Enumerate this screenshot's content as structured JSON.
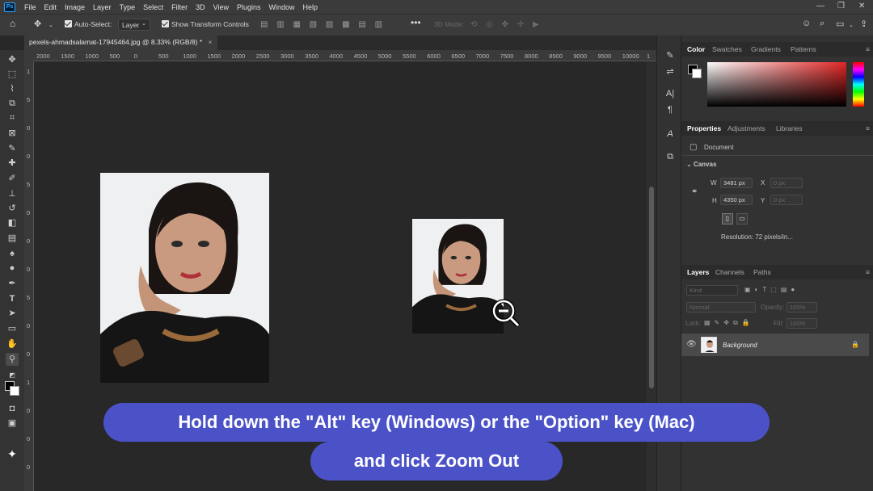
{
  "menu": [
    "File",
    "Edit",
    "Image",
    "Layer",
    "Type",
    "Select",
    "Filter",
    "3D",
    "View",
    "Plugins",
    "Window",
    "Help"
  ],
  "options": {
    "auto_select_label": "Auto-Select:",
    "auto_select_value": "Layer",
    "show_transform_label": "Show Transform Controls",
    "mode_3d_label": "3D Mode:"
  },
  "document": {
    "tab_title": "pexels-ahmadsalamat-17945464.jpg @ 8.33% (RGB/8) *",
    "close": "×"
  },
  "ruler_labels": [
    "2000",
    "1500",
    "1000",
    "500",
    "0",
    "500",
    "1000",
    "1500",
    "2000",
    "2500",
    "3000",
    "3500",
    "4000",
    "4500",
    "5000",
    "5500",
    "6000",
    "6500",
    "7000",
    "7500",
    "8000",
    "8500",
    "9000",
    "9500",
    "10000",
    "1"
  ],
  "ruler_v_labels": [
    "1",
    "5",
    "0",
    "0",
    "5",
    "0",
    "0",
    "0",
    "5",
    "0",
    "0",
    "1",
    "0",
    "0",
    "0"
  ],
  "panels": {
    "color_tabs": [
      "Color",
      "Swatches",
      "Gradients",
      "Patterns"
    ],
    "props_tabs": [
      "Properties",
      "Adjustments",
      "Libraries"
    ],
    "properties": {
      "doc_label": "Document",
      "canvas_label": "Canvas",
      "w_label": "W",
      "w_value": "3481 px",
      "h_label": "H",
      "h_value": "4350 px",
      "x_label": "X",
      "x_value": "0 px",
      "y_label": "Y",
      "y_value": "0 px",
      "resolution": "Resolution: 72 pixels/in..."
    },
    "layers_tabs": [
      "Layers",
      "Channels",
      "Paths"
    ],
    "layers": {
      "kind_placeholder": "Kind",
      "blend_mode": "Normal",
      "opacity_label": "Opacity:",
      "opacity_value": "100%",
      "lock_label": "Lock:",
      "fill_label": "Fill:",
      "fill_value": "100%",
      "layer_name": "Background"
    }
  },
  "captions": {
    "line1": "Hold down the \"Alt\" key (Windows) or the \"Option\" key (Mac)",
    "line2": "and click Zoom Out"
  },
  "colors": {
    "caption_bg": "#4b52c8",
    "app_bg": "#282828",
    "panel_bg": "#323232"
  }
}
